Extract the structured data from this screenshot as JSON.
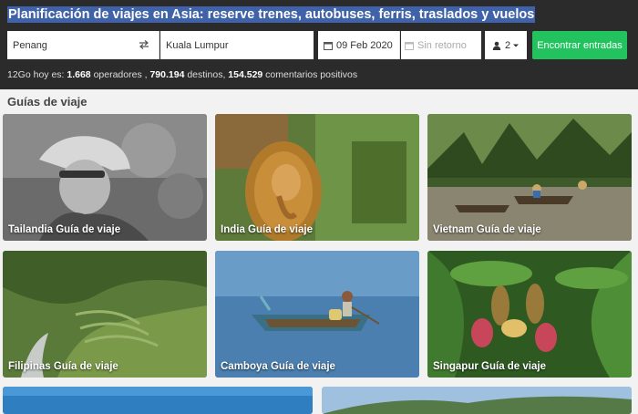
{
  "hero": {
    "title": "Planificación de viajes en Asia: reserve trenes, autobuses, ferris, traslados y vuelos"
  },
  "search": {
    "from_value": "Penang",
    "to_value": "Kuala Lumpur",
    "date_value": "09 Feb 2020",
    "return_placeholder": "Sin retorno",
    "passengers_value": "2",
    "button_label": "Encontrar entradas"
  },
  "stats": {
    "prefix": "12Go hoy es: ",
    "operators_count": "1.668",
    "operators_label": " operadores , ",
    "destinations_count": "790.194",
    "destinations_label": " destinos, ",
    "reviews_count": "154.529",
    "reviews_label": " comentarios positivos"
  },
  "guides": {
    "section_title": "Guías de viaje",
    "cards": [
      {
        "label": "Tailandia Guía de viaje"
      },
      {
        "label": "India Guía de viaje"
      },
      {
        "label": "Vietnam Guía de viaje"
      },
      {
        "label": "Filipinas Guía de viaje"
      },
      {
        "label": "Camboya Guía de viaje"
      },
      {
        "label": "Singapur Guía de viaje"
      }
    ]
  },
  "colors": {
    "hero_bg": "#2b2b2b",
    "title_highlight": "#3f62a8",
    "search_button": "#22c35e"
  }
}
